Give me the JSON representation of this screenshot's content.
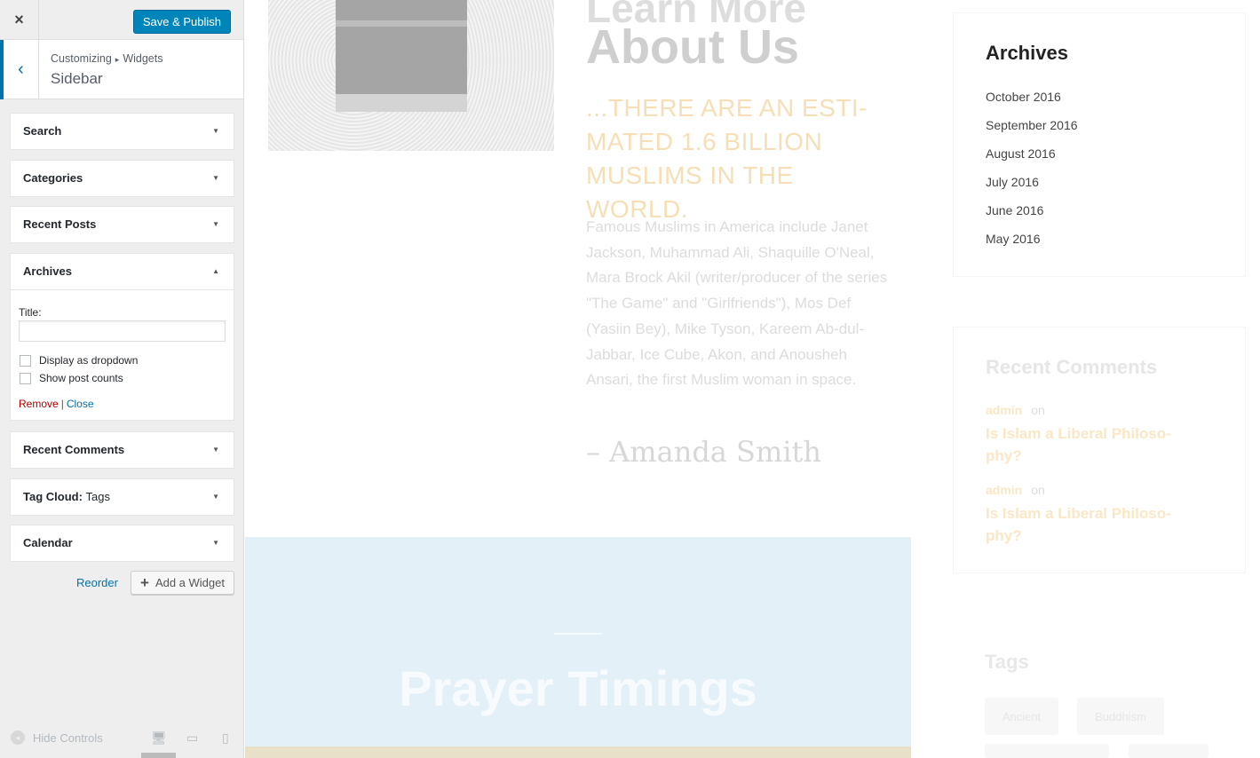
{
  "topbar": {
    "close_label": "×",
    "save_label": "Save & Publish"
  },
  "section": {
    "breadcrumb_root": "Customizing",
    "breadcrumb_sep": "▸",
    "breadcrumb_child": "Widgets",
    "title": "Sidebar",
    "back_icon": "‹"
  },
  "widgets": [
    {
      "title": "Search",
      "subtitle": ""
    },
    {
      "title": "Categories",
      "subtitle": ""
    },
    {
      "title": "Recent Posts",
      "subtitle": ""
    },
    {
      "title": "Archives",
      "subtitle": ""
    },
    {
      "title": "Recent Comments",
      "subtitle": ""
    },
    {
      "title": "Tag Cloud:",
      "subtitle": "Tags"
    },
    {
      "title": "Calendar",
      "subtitle": ""
    }
  ],
  "arrows": {
    "down": "▼",
    "up": "▲"
  },
  "archives_form": {
    "title_label": "Title:",
    "title_value": "",
    "dropdown_label": "Display as dropdown",
    "counts_label": "Show post counts",
    "remove_label": "Remove",
    "separator": "|",
    "close_label": "Close"
  },
  "actions": {
    "reorder_label": "Reorder",
    "add_label": "Add a Widget",
    "add_icon": "+"
  },
  "footer": {
    "hide_label": "Hide Controls",
    "hide_icon": "◂",
    "desktop_icon": "🖥",
    "tablet_icon": "▭",
    "mobile_icon": "▯"
  },
  "preview": {
    "headline_top": "Learn More",
    "headline": "About Us",
    "subheading": "...THERE ARE AN ESTI-MATED 1.6 BILLION MUSLIMS IN THE WORLD.",
    "body": "Famous Muslims in America include Janet Jackson, Muhammad Ali, Shaquille O'Neal, Mara Brock Akil (writer/producer of the series \"The Game\" and \"Girlfriends\"), Mos Def (Yasiin Bey), Mike Tyson, Kareem Ab-dul-Jabbar, Ice Cube, Akon, and Anousheh Ansari, the first Muslim woman in space.",
    "signature": "– Amanda Smith",
    "prayer_title": "Prayer Timings"
  },
  "archives": {
    "title": "Archives",
    "items": [
      "October 2016",
      "September 2016",
      "August 2016",
      "July 2016",
      "June 2016",
      "May 2016"
    ]
  },
  "recent_comments": {
    "title": "Recent Comments",
    "items": [
      {
        "author": "admin",
        "on": "on",
        "post": "Is Islam a Liberal Philoso-phy?"
      },
      {
        "author": "admin",
        "on": "on",
        "post": "Is Islam a Liberal Philoso-phy?"
      }
    ]
  },
  "tags": {
    "title": "Tags",
    "items": [
      "Ancient",
      "Buddhism"
    ]
  }
}
